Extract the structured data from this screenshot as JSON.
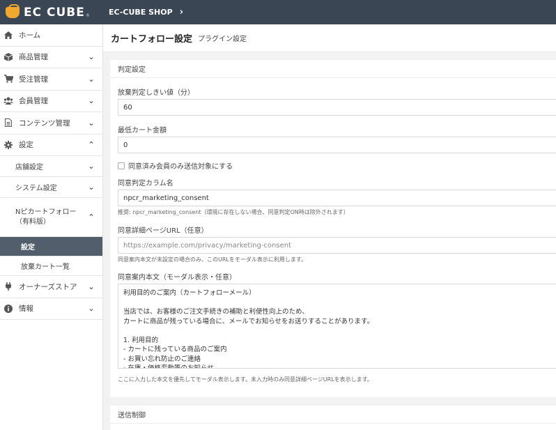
{
  "header": {
    "logo_text": "EC CUBE",
    "logo_sub": "®",
    "shop_name": "EC-CUBE SHOP"
  },
  "sidebar": {
    "items": [
      {
        "label": "ホーム",
        "icon": "home-icon"
      },
      {
        "label": "商品管理",
        "icon": "box-icon"
      },
      {
        "label": "受注管理",
        "icon": "cart-icon"
      },
      {
        "label": "会員管理",
        "icon": "users-icon"
      },
      {
        "label": "コンテンツ管理",
        "icon": "file-icon"
      },
      {
        "label": "設定",
        "icon": "gear-icon"
      },
      {
        "label": "店舗設定"
      },
      {
        "label": "システム設定"
      },
      {
        "label": "Nピカートフォロー（有料版）"
      },
      {
        "label": "設定"
      },
      {
        "label": "放棄カート一覧"
      },
      {
        "label": "オーナーズストア",
        "icon": "plug-icon"
      },
      {
        "label": "情報",
        "icon": "info-icon"
      }
    ]
  },
  "page": {
    "title": "カートフォロー設定",
    "subtitle": "プラグイン設定"
  },
  "form": {
    "section_title": "判定設定",
    "threshold_label": "放棄判定しきい値（分）",
    "threshold_value": "60",
    "min_amount_label": "最低カート金額",
    "min_amount_value": "0",
    "consent_only_label": "同意済み会員のみ送信対象にする",
    "consent_column_label": "同意判定カラム名",
    "consent_column_value": "npcr_marketing_consent",
    "consent_column_help": "推奨: npcr_marketing_consent（環境に存在しない場合、同意判定ON時は除外されます）",
    "consent_url_label": "同意詳細ページURL（任意）",
    "consent_url_placeholder": "https://example.com/privacy/marketing-consent",
    "consent_url_help": "同意案内本文が未設定の場合のみ、このURLをモーダル表示に利用します。",
    "consent_text_label": "同意案内本文（モーダル表示・任意）",
    "consent_text_value": "利用目的のご案内（カートフォローメール）\n\n当店では、お客様のご注文手続きの補助と利便性向上のため、\nカートに商品が残っている場合に、メールでお知らせをお送りすることがあります。\n\n1. 利用目的\n- カートに残っている商品のご案内\n- お買い忘れ防止のご連絡\n- 在庫・価格変動等のお知らせ",
    "consent_text_help": "ここに入力した本文を優先してモーダル表示します。未入力時のみ同意詳細ページURLを表示します。",
    "section2_title": "送信制御"
  }
}
